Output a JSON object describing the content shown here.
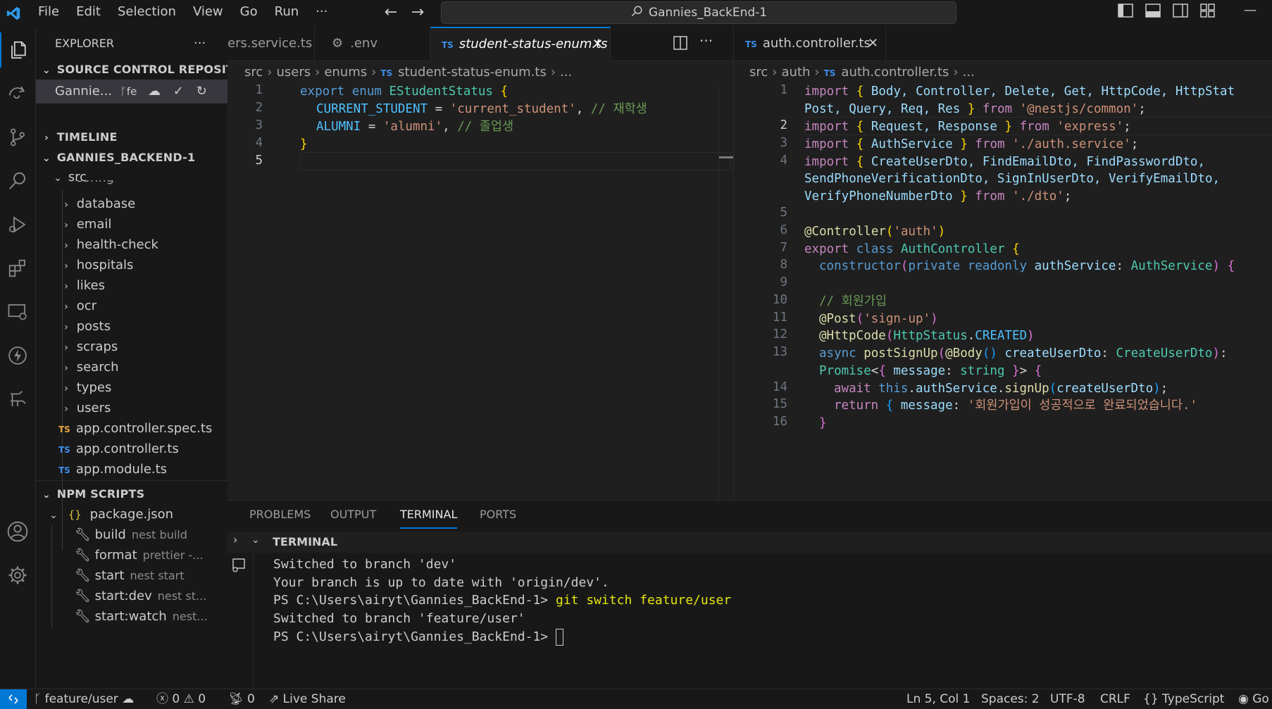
{
  "menu": [
    "File",
    "Edit",
    "Selection",
    "View",
    "Go",
    "Run",
    "···"
  ],
  "command_center": "Gannies_BackEnd-1",
  "sidebar": {
    "title": "EXPLORER",
    "more": "···",
    "scm_section": "SOURCE CONTROL REPOSIT...",
    "scm_repo": "Gannie...",
    "scm_branch": "fe",
    "timeline": "TIMELINE",
    "project": "GANNIES_BACKEND-1",
    "src": "src",
    "partial": "config",
    "folders": [
      "database",
      "email",
      "health-check",
      "hospitals",
      "likes",
      "ocr",
      "posts",
      "scraps",
      "search",
      "types",
      "users"
    ],
    "files": [
      "app.controller.spec.ts",
      "app.controller.ts",
      "app.module.ts"
    ],
    "npm": "NPM SCRIPTS",
    "package": "package.json",
    "scripts": [
      {
        "name": "build",
        "cmd": "nest build"
      },
      {
        "name": "format",
        "cmd": "prettier -..."
      },
      {
        "name": "start",
        "cmd": "nest start"
      },
      {
        "name": "start:dev",
        "cmd": "nest st..."
      },
      {
        "name": "start:watch",
        "cmd": "nest..."
      }
    ]
  },
  "group1": {
    "tabs": [
      "ers.service.ts",
      ".env",
      "student-status-enum.ts"
    ],
    "breadcrumb": [
      "src",
      "users",
      "enums",
      "student-status-enum.ts",
      "..."
    ],
    "lines": [
      "1",
      "2",
      "3",
      "4",
      "5"
    ],
    "code": {
      "l1a": "export",
      "l1b": "enum",
      "l1c": "EStudentStatus",
      "l1d": "{",
      "l2a": "CURRENT_STUDENT",
      "l2b": " = ",
      "l2c": "'current_student'",
      "l2d": ", ",
      "l2e": "// 재학생",
      "l3a": "ALUMNI",
      "l3b": " = ",
      "l3c": "'alumni'",
      "l3d": ", ",
      "l3e": "// 졸업생",
      "l4a": "}"
    }
  },
  "group2": {
    "tab": "auth.controller.ts",
    "breadcrumb": [
      "src",
      "auth",
      "auth.controller.ts",
      "..."
    ],
    "lines": [
      "1",
      "2",
      "3",
      "4",
      "5",
      "6",
      "7",
      "8",
      "9",
      "10",
      "11",
      "12",
      "13",
      "14",
      "15",
      "16"
    ],
    "code": {
      "import": "import",
      "from": "from",
      "i1": "Body, Controller, Delete, Get, HttpCode, HttpStat",
      "i1b": "Post, Query, Req, Res",
      "i1s": "'@nestjs/common'",
      "i2": "Request, Response",
      "i2s": "'express'",
      "i3": "AuthService",
      "i3s": "'./auth.service'",
      "i4": "CreateUserDto, FindEmailDto, FindPasswordDto,",
      "i4b": "SendPhoneVerificationDto, SignInUserDto, VerifyEmailDto,",
      "i4c": "VerifyPhoneNumberDto",
      "i4s": "'./dto'",
      "dec1": "@Controller",
      "dec1s": "'auth'",
      "export": "export",
      "class": "class",
      "clsname": "AuthController",
      "ctor": "constructor",
      "priv": "private readonly",
      "authsvc": "authService",
      "authtype": "AuthService",
      "cmt": "// 회원가입",
      "post": "@Post",
      "posts": "'sign-up'",
      "httpcode": "@HttpCode",
      "httpstatus": "HttpStatus",
      "created": "CREATED",
      "async": "async",
      "method": "postSignUp",
      "body": "@Body",
      "dtoarg": "createUserDto",
      "dtotype": "CreateUserDto",
      "promise": "Promise",
      "message": "message",
      "stringt": "string",
      "await": "await",
      "this": "this",
      "authsvc2": "authService",
      "signup": "signUp",
      "return": "return",
      "retstr": "'회원가입이 성공적으로 완료되었습니다.'"
    }
  },
  "panel": {
    "tabs": [
      "PROBLEMS",
      "OUTPUT",
      "TERMINAL",
      "PORTS"
    ],
    "terminal_title": "TERMINAL",
    "lines": [
      "Switched to branch 'dev'",
      "Your branch is up to date with 'origin/dev'."
    ],
    "prompt": "PS C:\\Users\\airyt\\Gannies_BackEnd-1>",
    "command": "git switch feature/user",
    "line4": "Switched to branch 'feature/user'"
  },
  "status": {
    "branch": "feature/user",
    "errors": "0",
    "warnings": "0",
    "ports": "0",
    "liveshare": "Live Share",
    "position": "Ln 5, Col 1",
    "spaces": "Spaces: 2",
    "encoding": "UTF-8",
    "eol": "CRLF",
    "language": "TypeScript",
    "golive": "Go"
  },
  "colors": {
    "accent": "#0078d4",
    "ts": "#3b8eea"
  }
}
